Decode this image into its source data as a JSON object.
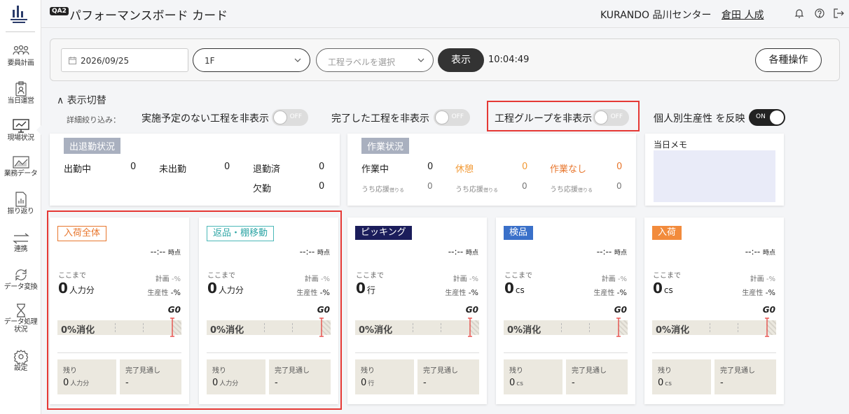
{
  "header": {
    "badge": "QA2",
    "title": "パフォーマンスボード カード",
    "company": "KURANDO 品川センター",
    "user": "倉田 人成",
    "icons": [
      "bell-icon",
      "help-icon",
      "logout-icon"
    ]
  },
  "sidebar": {
    "items": [
      {
        "label": "要員計画",
        "icon": "people-icon"
      },
      {
        "label": "当日運営",
        "icon": "clipboard-icon"
      },
      {
        "label": "現場状況",
        "icon": "monitor-icon"
      },
      {
        "label": "業務データ",
        "icon": "chart-area-icon"
      },
      {
        "label": "振り返り",
        "icon": "report-icon"
      },
      {
        "label": "連携",
        "icon": "arrows-icon"
      },
      {
        "label": "データ変換",
        "icon": "refresh-icon"
      },
      {
        "label": "データ処理\n状況",
        "icon": "hourglass-icon"
      },
      {
        "label": "設定",
        "icon": "gear-icon"
      }
    ]
  },
  "filters": {
    "date": "2026/09/25",
    "floor": "1F",
    "label_placeholder": "工程ラベルを選択",
    "show_button": "表示",
    "time": "10:04:49",
    "ops_button": "各種操作"
  },
  "toggles": {
    "section_label": "表示切替",
    "filter_label": "詳細絞り込み：",
    "hide_unplanned": {
      "label": "実施予定のない工程を非表示",
      "state": "OFF"
    },
    "hide_completed": {
      "label": "完了した工程を非表示",
      "state": "OFF"
    },
    "hide_group": {
      "label": "工程グループを非表示",
      "state": "OFF"
    },
    "personal_productivity": {
      "label": "個人別生産性 を反映",
      "state": "ON"
    }
  },
  "attendance": {
    "tag": "出退勤状況",
    "working_label": "出勤中",
    "working": "0",
    "not_arrived_label": "未出勤",
    "not_arrived": "0",
    "left_label": "退勤済",
    "left": "0",
    "absent_label": "欠勤",
    "absent": "0"
  },
  "work_status": {
    "tag": "作業状況",
    "working_label": "作業中",
    "working": "0",
    "break_label": "休憩",
    "break": "0",
    "idle_label": "作業なし",
    "idle": "0",
    "support_label": "うち応援",
    "support_suffix": "借りる",
    "support_working": "0",
    "support_break": "0",
    "support_idle": "0"
  },
  "memo": {
    "title": "当日メモ"
  },
  "card_common": {
    "time": "--:--",
    "time_suffix": "時点",
    "sofar": "ここまで",
    "plan_label": "計画",
    "plan_value": "-%",
    "prod_label": "生産性",
    "prod_value": "-%",
    "g0": "G0",
    "consumed": "0%消化",
    "remaining_label": "残り",
    "forecast_label": "完了見通し",
    "forecast_value": "-"
  },
  "cards": [
    {
      "tag": "入荷全体",
      "value": "0",
      "unit": "人力分",
      "remaining": "0",
      "remaining_unit": "人力分",
      "accent": "#e8772e"
    },
    {
      "tag": "返品・棚移動",
      "value": "0",
      "unit": "人力分",
      "remaining": "0",
      "remaining_unit": "人力分",
      "accent": "#4bb8b8"
    },
    {
      "tag": "ピッキング",
      "value": "0",
      "unit": "行",
      "remaining": "0",
      "remaining_unit": "行",
      "accent": "#1b1d5b"
    },
    {
      "tag": "検品",
      "value": "0",
      "unit": "cs",
      "remaining": "0",
      "remaining_unit": "cs",
      "accent": "#3a70c9"
    },
    {
      "tag": "入荷",
      "value": "0",
      "unit": "cs",
      "remaining": "0",
      "remaining_unit": "cs",
      "accent": "#f28b3c"
    }
  ]
}
